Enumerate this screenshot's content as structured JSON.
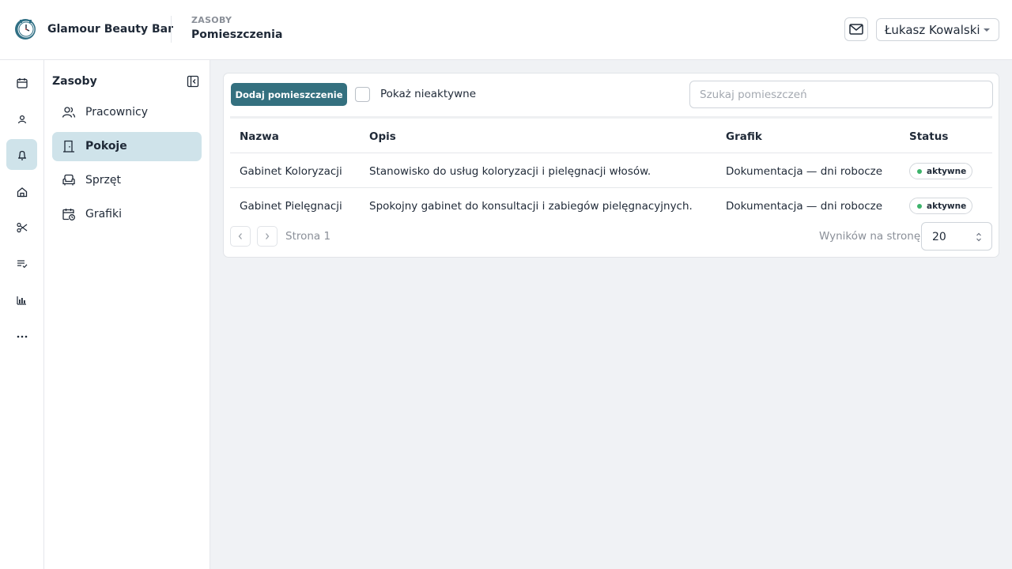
{
  "header": {
    "brand": "Glamour Beauty Bar",
    "section": "ZASOBY",
    "title": "Pomieszczenia",
    "user_name": "Łukasz Kowalski",
    "mail_icon": "mail-icon"
  },
  "rail": {
    "items": [
      {
        "name": "calendar",
        "icon": "calendar-icon"
      },
      {
        "name": "clients",
        "icon": "person-icon"
      },
      {
        "name": "resources",
        "icon": "bell-icon",
        "active": true
      },
      {
        "name": "salon",
        "icon": "home-icon"
      },
      {
        "name": "services",
        "icon": "scissors-icon"
      },
      {
        "name": "tasks",
        "icon": "checklist-icon"
      },
      {
        "name": "reports",
        "icon": "bar-chart-icon"
      },
      {
        "name": "more",
        "icon": "more-icon"
      }
    ]
  },
  "subnav": {
    "title": "Zasoby",
    "items": [
      {
        "label": "Pracownicy",
        "icon": "users-icon"
      },
      {
        "label": "Pokoje",
        "icon": "door-icon",
        "active": true
      },
      {
        "label": "Sprzęt",
        "icon": "armchair-icon"
      },
      {
        "label": "Grafiki",
        "icon": "calendar-clock-icon"
      }
    ]
  },
  "toolbar": {
    "add_label": "Dodaj pomieszczenie",
    "show_inactive_label": "Pokaż nieaktywne",
    "search_placeholder": "Szukaj pomieszczeń"
  },
  "table": {
    "columns": [
      "Nazwa",
      "Opis",
      "Grafik",
      "Status"
    ],
    "rows": [
      {
        "name": "Gabinet Koloryzacji",
        "description": "Stanowisko do usług koloryzacji i pielęgnacji włosów.",
        "schedule": "Dokumentacja — dni robocze",
        "status": "aktywne"
      },
      {
        "name": "Gabinet Pielęgnacji",
        "description": "Spokojny gabinet do konsultacji i zabiegów pielęgnacyjnych.",
        "schedule": "Dokumentacja — dni robocze",
        "status": "aktywne"
      }
    ]
  },
  "pagination": {
    "page_label": "Strona 1",
    "per_page_label": "Wyników na stronę",
    "per_page_value": "20"
  },
  "colors": {
    "accent": "#34707f",
    "active_bg": "#cfe3ea",
    "status_dot": "#3db36b"
  }
}
